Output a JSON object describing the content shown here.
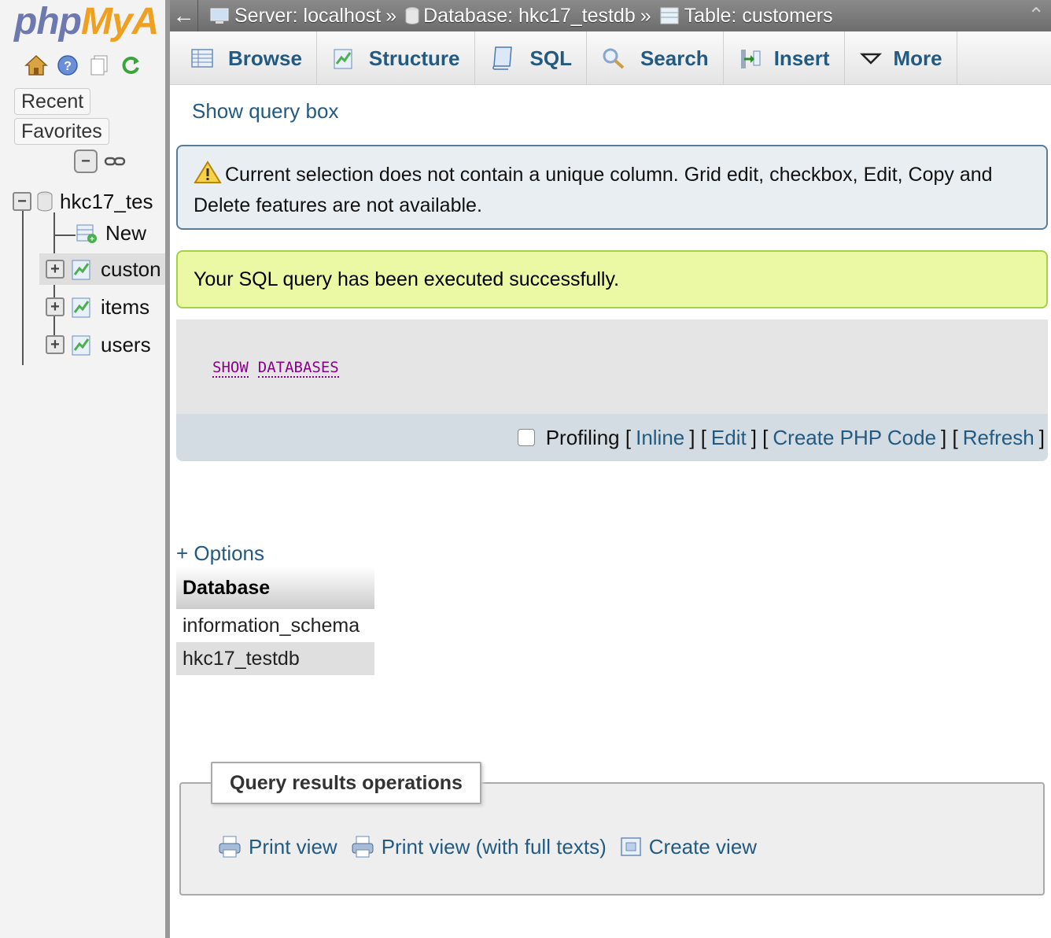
{
  "nav": {
    "logo_php": "php",
    "logo_my": "MyA",
    "recent_label": "Recent",
    "favorites_label": "Favorites",
    "tree": {
      "database": "hkc17_tes",
      "new_label": "New",
      "tables": [
        "custon",
        "items",
        "users"
      ]
    }
  },
  "breadcrumb": {
    "server": "Server: localhost",
    "database": "Database: hkc17_testdb",
    "table": "Table: customers",
    "separator": "»"
  },
  "tabs": [
    {
      "label": "Browse",
      "icon": "browse-icon"
    },
    {
      "label": "Structure",
      "icon": "structure-icon"
    },
    {
      "label": "SQL",
      "icon": "sql-icon"
    },
    {
      "label": "Search",
      "icon": "search-icon"
    },
    {
      "label": "Insert",
      "icon": "insert-icon"
    },
    {
      "label": "More",
      "icon": "caret-down-icon"
    }
  ],
  "main": {
    "show_query_box": "Show query box",
    "notice_text": "Current selection does not contain a unique column. Grid edit, checkbox, Edit, Copy and Delete features are not available.",
    "success_text": "Your SQL query has been executed successfully.",
    "sql": {
      "keyword1": "SHOW",
      "keyword2": "DATABASES"
    },
    "sql_tools": {
      "profiling": "Profiling",
      "inline": "Inline",
      "edit": "Edit",
      "create_php": "Create PHP Code",
      "refresh": "Refresh"
    },
    "options_link": "+ Options",
    "table": {
      "header": "Database",
      "rows": [
        "information_schema",
        "hkc17_testdb"
      ]
    },
    "operations": {
      "legend": "Query results operations",
      "print_view": "Print view",
      "print_view_full": "Print view (with full texts)",
      "create_view": "Create view"
    }
  },
  "colors": {
    "link": "#235a81",
    "success_bg": "#ebf8a4",
    "notice_bg": "#e8eef2",
    "sql_keyword": "#8b008b"
  }
}
